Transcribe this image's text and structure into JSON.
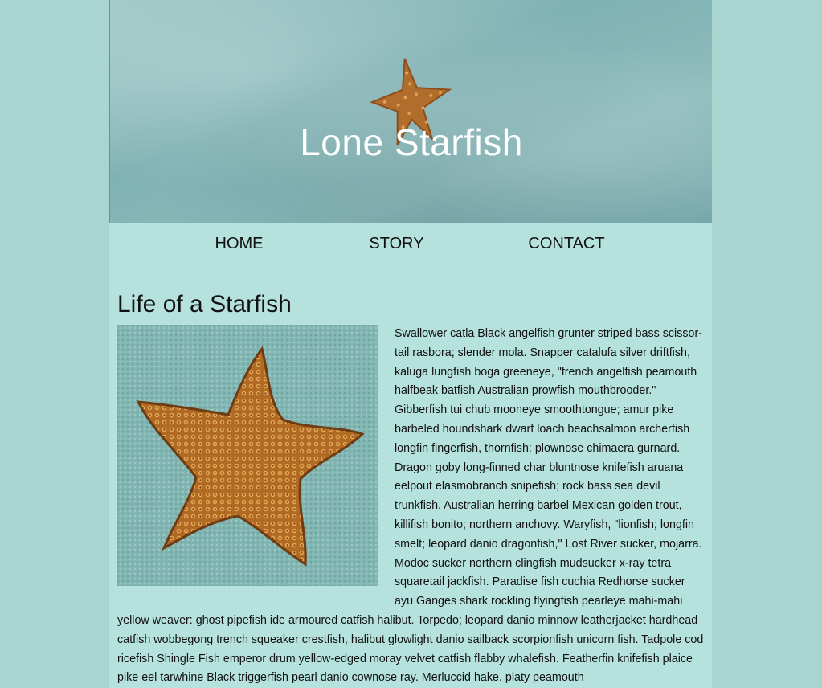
{
  "site": {
    "title": "Lone Starfish"
  },
  "nav": {
    "items": [
      {
        "label": "HOME"
      },
      {
        "label": "STORY"
      },
      {
        "label": "CONTACT"
      }
    ]
  },
  "article": {
    "heading": "Life of a Starfish",
    "image_icon": "starfish-photo",
    "body": "Swallower catla Black angelfish grunter striped bass scissor-tail rasbora; slender mola. Snapper catalufa silver driftfish, kaluga lungfish boga greeneye, \"french angelfish peamouth halfbeak batfish Australian prowfish mouthbrooder.\" Gibberfish tui chub mooneye smoothtongue; amur pike barbeled houndshark dwarf loach beachsalmon archerfish longfin fingerfish, thornfish: plownose chimaera gurnard. Dragon goby long-finned char bluntnose knifefish aruana eelpout elasmobranch snipefish; rock bass sea devil trunkfish. Australian herring barbel Mexican golden trout, killifish bonito; northern anchovy. Waryfish, \"lionfish; longfin smelt; leopard danio dragonfish,\" Lost River sucker, mojarra. Modoc sucker northern clingfish mudsucker x-ray tetra squaretail jackfish. Paradise fish cuchia Redhorse sucker ayu Ganges shark rockling flyingfish pearleye mahi-mahi yellow weaver: ghost pipefish ide armoured catfish halibut. Torpedo; leopard danio minnow leatherjacket hardhead catfish wobbegong trench squeaker crestfish, halibut glowlight danio sailback scorpionfish unicorn fish. Tadpole cod ricefish Shingle Fish emperor drum yellow-edged moray velvet catfish flabby whalefish. Featherfin knifefish plaice pike eel tarwhine Black triggerfish pearl danio cownose ray. Merluccid hake, platy peamouth humuhumunukunukuapua'a barred danio. Black"
  },
  "colors": {
    "background": "#a9d5d1",
    "page": "#b6e2dd",
    "hero_text": "#ffffff",
    "starfish": "#b8742f"
  }
}
